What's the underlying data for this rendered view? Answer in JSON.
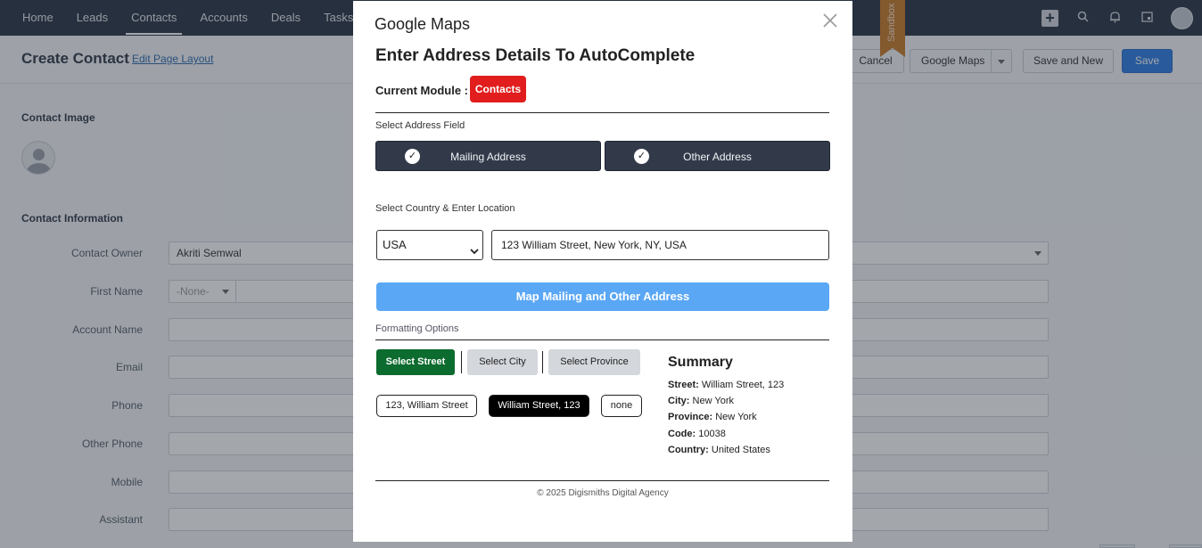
{
  "nav": {
    "items": [
      "Home",
      "Leads",
      "Contacts",
      "Accounts",
      "Deals",
      "Tasks"
    ],
    "active": "Contacts",
    "right_icons": [
      "plus-icon",
      "search-icon",
      "bell-icon",
      "calendar-icon",
      "user-avatar"
    ]
  },
  "header": {
    "title": "Create Contact",
    "edit_layout": "Edit Page Layout",
    "cancel": "Cancel",
    "google_maps": "Google Maps",
    "save_and_new": "Save and New",
    "save": "Save",
    "sandbox": "Sandbox"
  },
  "form": {
    "contact_image": "Contact Image",
    "contact_information": "Contact Information",
    "labels": {
      "owner": "Contact Owner",
      "first_name": "First Name",
      "account_name": "Account Name",
      "email": "Email",
      "phone": "Phone",
      "other_phone": "Other Phone",
      "mobile": "Mobile",
      "assistant": "Assistant"
    },
    "owner_value": "Akriti Semwal",
    "salutation": "-None-"
  },
  "modal": {
    "title": "Google Maps",
    "heading": "Enter Address Details To AutoComplete",
    "module_label": "Current Module :",
    "module_value": "Contacts",
    "select_address_label": "Select Address Field",
    "mailing_address": "Mailing Address",
    "other_address": "Other Address",
    "check_glyph": "✓",
    "country_location_label": "Select Country & Enter Location",
    "country": "USA",
    "location": "123 William Street, New York, NY, USA",
    "map_button": "Map Mailing and Other Address",
    "formatting_label": "Formatting Options",
    "select_street": "Select Street",
    "select_city": "Select City",
    "select_province": "Select Province",
    "street_options": [
      "123, William Street",
      "William Street, 123",
      "none"
    ],
    "selected_street_option": "William Street, 123",
    "summary": {
      "title": "Summary",
      "street_label": "Street:",
      "street": "William Street, 123",
      "city_label": "City:",
      "city": "New York",
      "province_label": "Province:",
      "province": "New York",
      "code_label": "Code:",
      "code": "10038",
      "country_label": "Country:",
      "country": "United States"
    },
    "footer": "© 2025 Digismiths Digital Agency"
  },
  "colors": {
    "nav_bg": "#2a3444",
    "module_badge": "#e11d1d",
    "address_button": "#323a4a",
    "map_button": "#5aa7f5",
    "select_street_button": "#0c6b2e",
    "save_button": "#2d7de4"
  }
}
